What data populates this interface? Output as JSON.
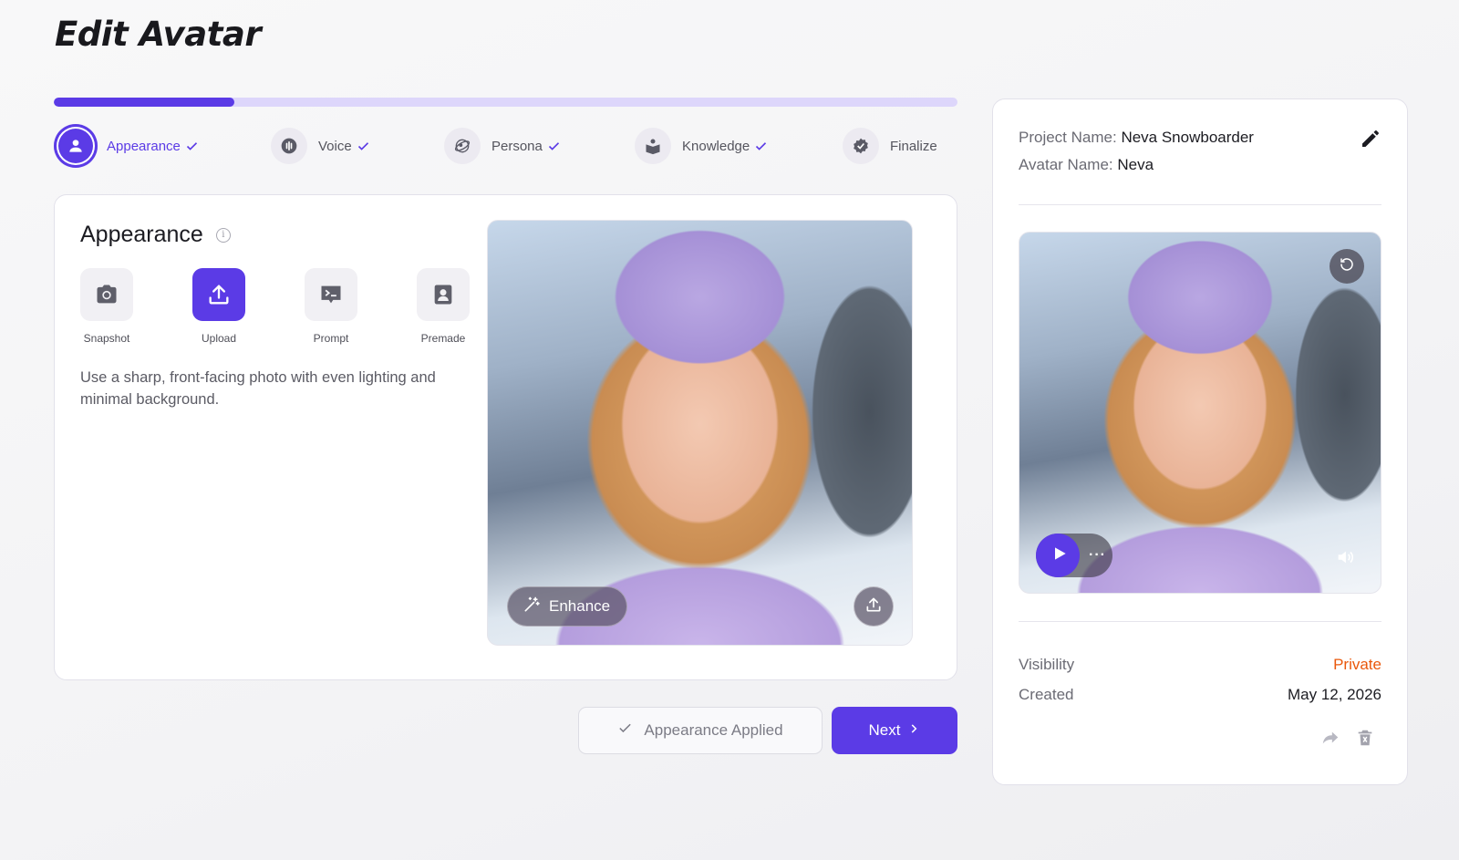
{
  "page_title": "Edit Avatar",
  "progress": {
    "percent": 20,
    "accent": "#5b3be6",
    "track": "#ddd6fb"
  },
  "steps": [
    {
      "label": "Appearance",
      "icon": "user-icon",
      "done": true,
      "active": true
    },
    {
      "label": "Voice",
      "icon": "waveform-icon",
      "done": true
    },
    {
      "label": "Persona",
      "icon": "persona-icon",
      "done": true
    },
    {
      "label": "Knowledge",
      "icon": "book-icon",
      "done": true
    },
    {
      "label": "Finalize",
      "icon": "badge-check-icon",
      "done": false
    }
  ],
  "appearance": {
    "title": "Appearance",
    "info_icon": "i",
    "tools": [
      {
        "label": "Snapshot",
        "icon": "camera-icon"
      },
      {
        "label": "Upload",
        "icon": "upload-icon",
        "active": true
      },
      {
        "label": "Prompt",
        "icon": "terminal-chat-icon"
      },
      {
        "label": "Premade",
        "icon": "portrait-icon"
      }
    ],
    "hint": "Use a sharp, front-facing photo with even lighting and minimal background.",
    "enhance_label": "Enhance"
  },
  "actions": {
    "applied_label": "Appearance Applied",
    "next_label": "Next"
  },
  "summary": {
    "project_key": "Project Name:",
    "project_value": "Neva Snowboarder",
    "avatar_key": "Avatar Name:",
    "avatar_value": "Neva",
    "player_more": "···",
    "visibility_key": "Visibility",
    "visibility_value": "Private",
    "visibility_color": "#ea580c",
    "created_key": "Created",
    "created_value": "May 12, 2026"
  }
}
